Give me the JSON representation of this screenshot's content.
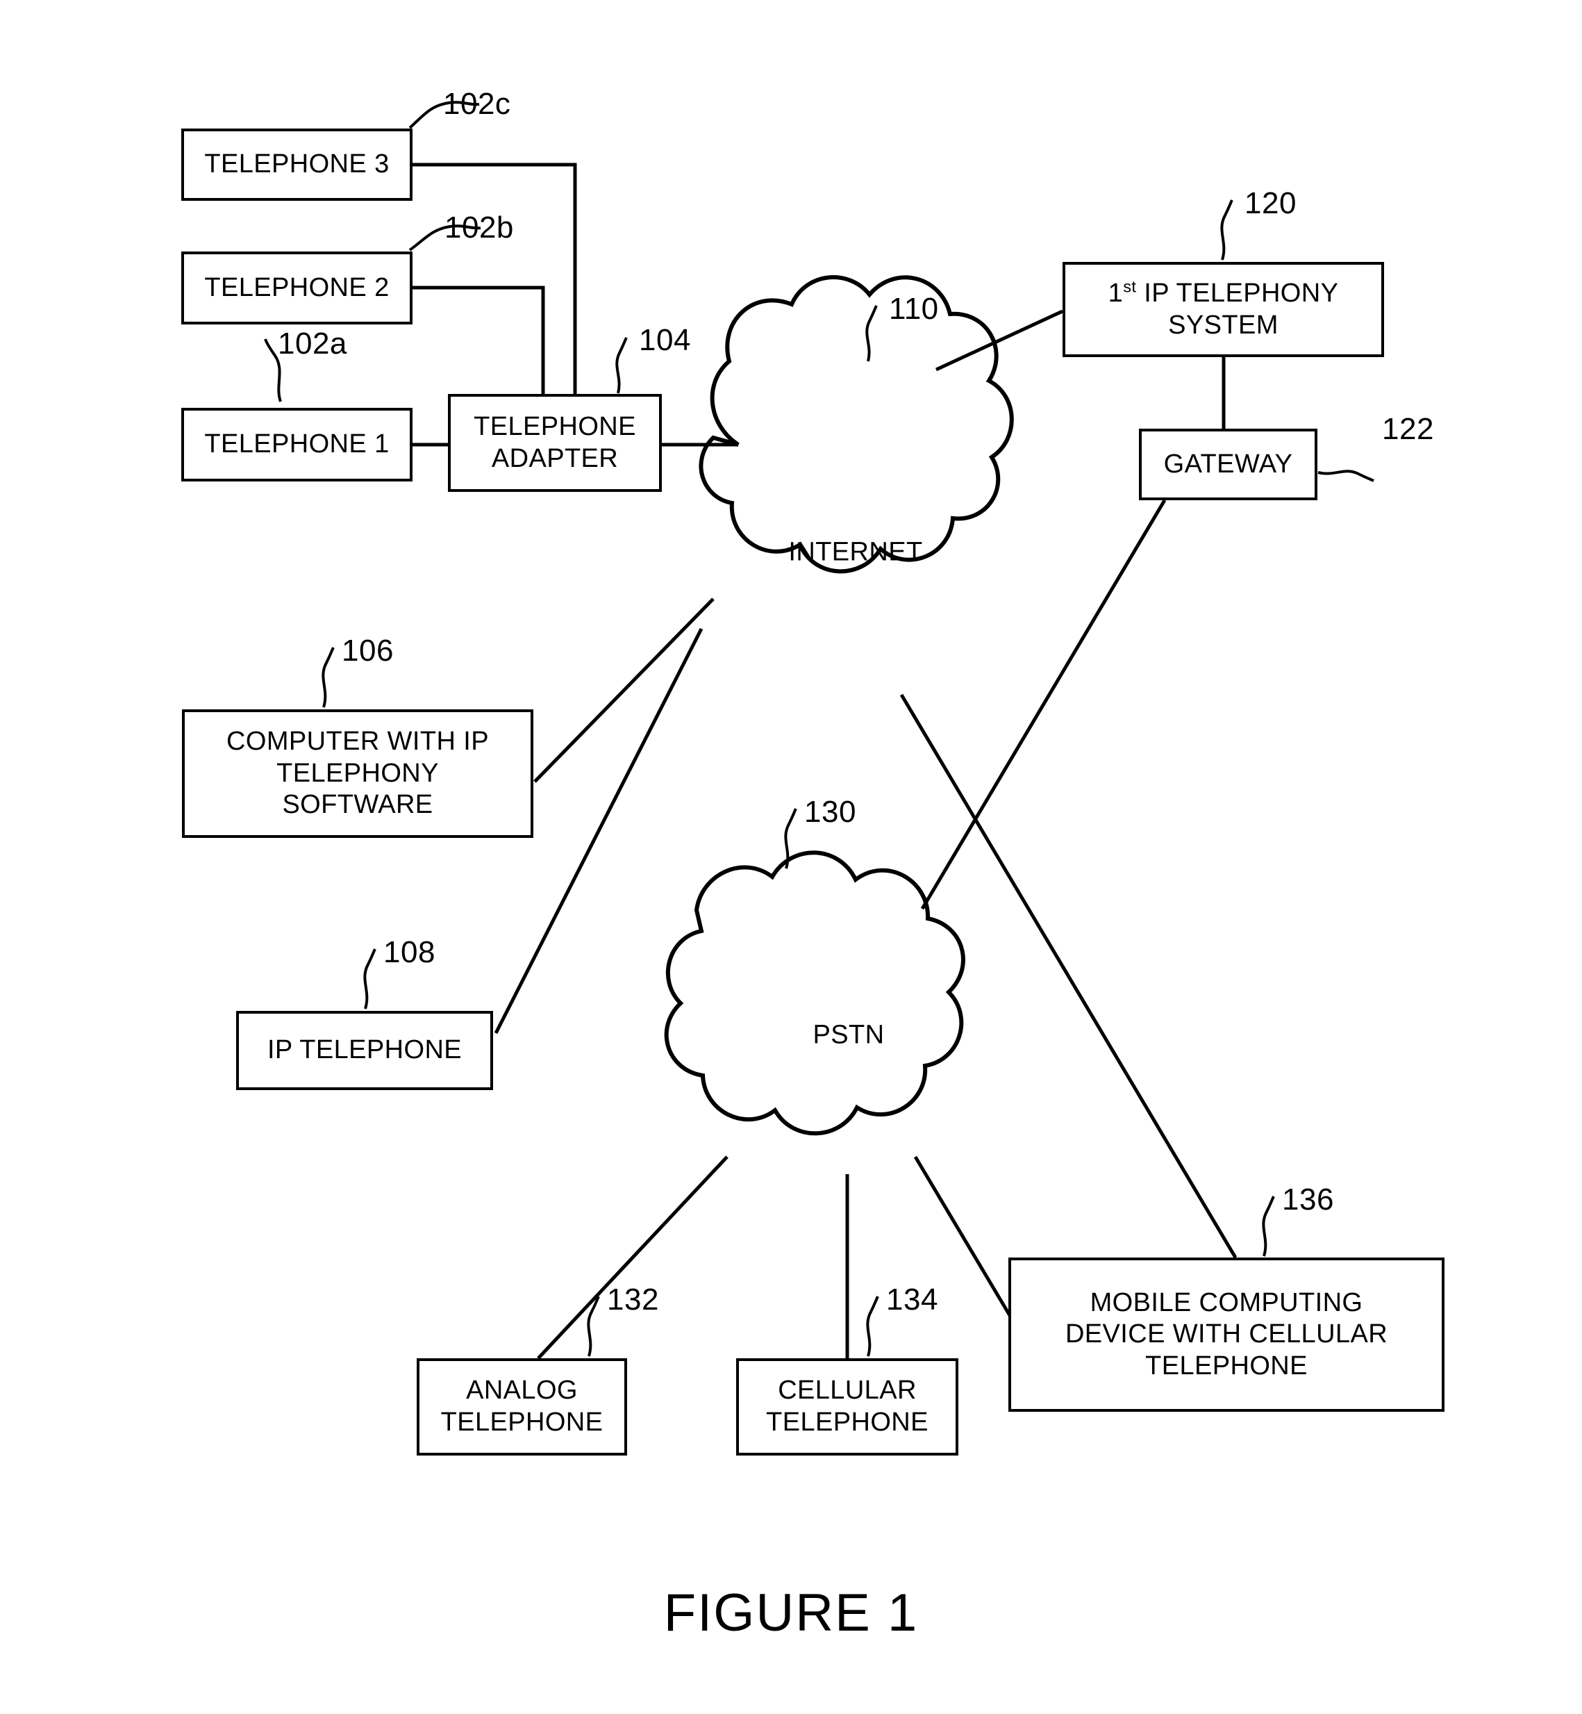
{
  "figure": {
    "caption": "FIGURE 1"
  },
  "nodes": {
    "telephone3": {
      "label": "TELEPHONE 3",
      "ref": "102c"
    },
    "telephone2": {
      "label": "TELEPHONE 2",
      "ref": "102b"
    },
    "telephone1": {
      "label": "TELEPHONE 1",
      "ref": "102a"
    },
    "telephone_adapter": {
      "line1": "TELEPHONE",
      "line2": "ADAPTER",
      "ref": "104"
    },
    "internet": {
      "label": "INTERNET",
      "ref": "110"
    },
    "ip_telephony_system": {
      "prefix": "1",
      "ordinal": "st",
      "rest": " IP TELEPHONY",
      "line2": "SYSTEM",
      "ref": "120"
    },
    "gateway": {
      "label": "GATEWAY",
      "ref": "122"
    },
    "computer": {
      "line1": "COMPUTER WITH IP",
      "line2": "TELEPHONY",
      "line3": "SOFTWARE",
      "ref": "106"
    },
    "ip_telephone": {
      "label": "IP TELEPHONE",
      "ref": "108"
    },
    "pstn": {
      "label": "PSTN",
      "ref": "130"
    },
    "analog_telephone": {
      "line1": "ANALOG",
      "line2": "TELEPHONE",
      "ref": "132"
    },
    "cellular_telephone": {
      "line1": "CELLULAR",
      "line2": "TELEPHONE",
      "ref": "134"
    },
    "mobile_device": {
      "line1": "MOBILE COMPUTING",
      "line2": "DEVICE WITH CELLULAR",
      "line3": "TELEPHONE",
      "ref": "136"
    }
  },
  "connections": [
    {
      "from": "telephone1",
      "to": "telephone_adapter"
    },
    {
      "from": "telephone2",
      "to": "telephone_adapter"
    },
    {
      "from": "telephone3",
      "to": "telephone_adapter"
    },
    {
      "from": "telephone_adapter",
      "to": "internet"
    },
    {
      "from": "internet",
      "to": "ip_telephony_system"
    },
    {
      "from": "ip_telephony_system",
      "to": "gateway"
    },
    {
      "from": "gateway",
      "to": "pstn"
    },
    {
      "from": "internet",
      "to": "computer"
    },
    {
      "from": "internet",
      "to": "ip_telephone"
    },
    {
      "from": "internet",
      "to": "mobile_device"
    },
    {
      "from": "pstn",
      "to": "analog_telephone"
    },
    {
      "from": "pstn",
      "to": "cellular_telephone"
    },
    {
      "from": "pstn",
      "to": "mobile_device"
    }
  ],
  "colors": {
    "stroke": "#000000",
    "background": "#ffffff"
  }
}
